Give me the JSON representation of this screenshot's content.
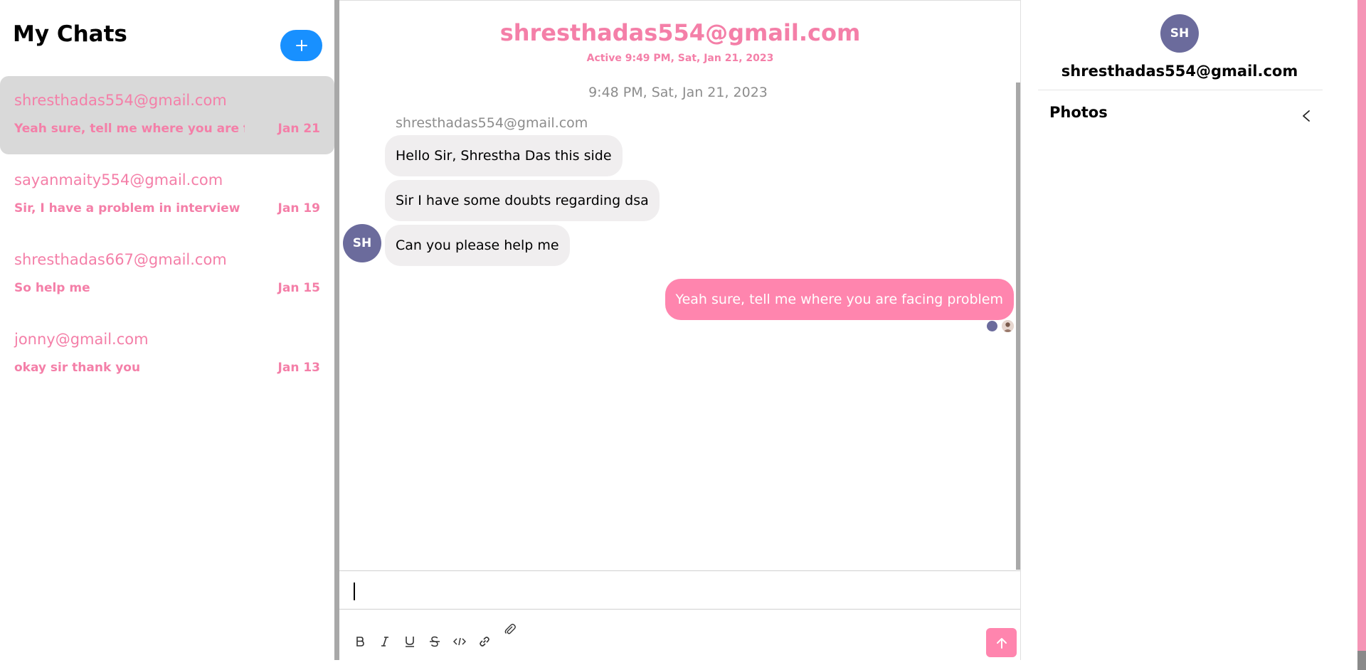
{
  "sidebar": {
    "title": "My Chats",
    "new_chat_label": "+",
    "chats": [
      {
        "email": "shresthadas554@gmail.com",
        "preview": "Yeah sure, tell me where you are facing problem",
        "date": "Jan 21",
        "active": true
      },
      {
        "email": "sayanmaity554@gmail.com",
        "preview": "Sir, I have a problem in interview question",
        "date": "Jan 19",
        "active": false
      },
      {
        "email": "shresthadas667@gmail.com",
        "preview": "So help me",
        "date": "Jan 15",
        "active": false
      },
      {
        "email": "jonny@gmail.com",
        "preview": "okay sir thank you",
        "date": "Jan 13",
        "active": false
      }
    ]
  },
  "chat": {
    "header_email": "shresthadas554@gmail.com",
    "header_status": "Active 9:49 PM, Sat, Jan 21, 2023",
    "timestamp": "9:48 PM, Sat, Jan 21, 2023",
    "sender_name": "shresthadas554@gmail.com",
    "sender_avatar": "SH",
    "incoming_messages": [
      "Hello Sir, Shrestha Das this side",
      "Sir I have some doubts regarding dsa",
      "Can you please help me"
    ],
    "outgoing_message": "Yeah sure, tell me where you are facing problem",
    "input_value": "",
    "toolbar_icons": [
      "bold-icon",
      "italic-icon",
      "underline-icon",
      "strikethrough-icon",
      "code-icon",
      "link-icon",
      "attachment-icon"
    ]
  },
  "profile": {
    "avatar": "SH",
    "email": "shresthadas554@gmail.com",
    "photos_label": "Photos"
  },
  "colors": {
    "accent_pink": "#f47fa8",
    "bubble_pink": "#ff85ae",
    "new_chat_blue": "#1890ff",
    "avatar_purple": "#6b6b9c",
    "active_item_bg": "#d9d9d9"
  }
}
